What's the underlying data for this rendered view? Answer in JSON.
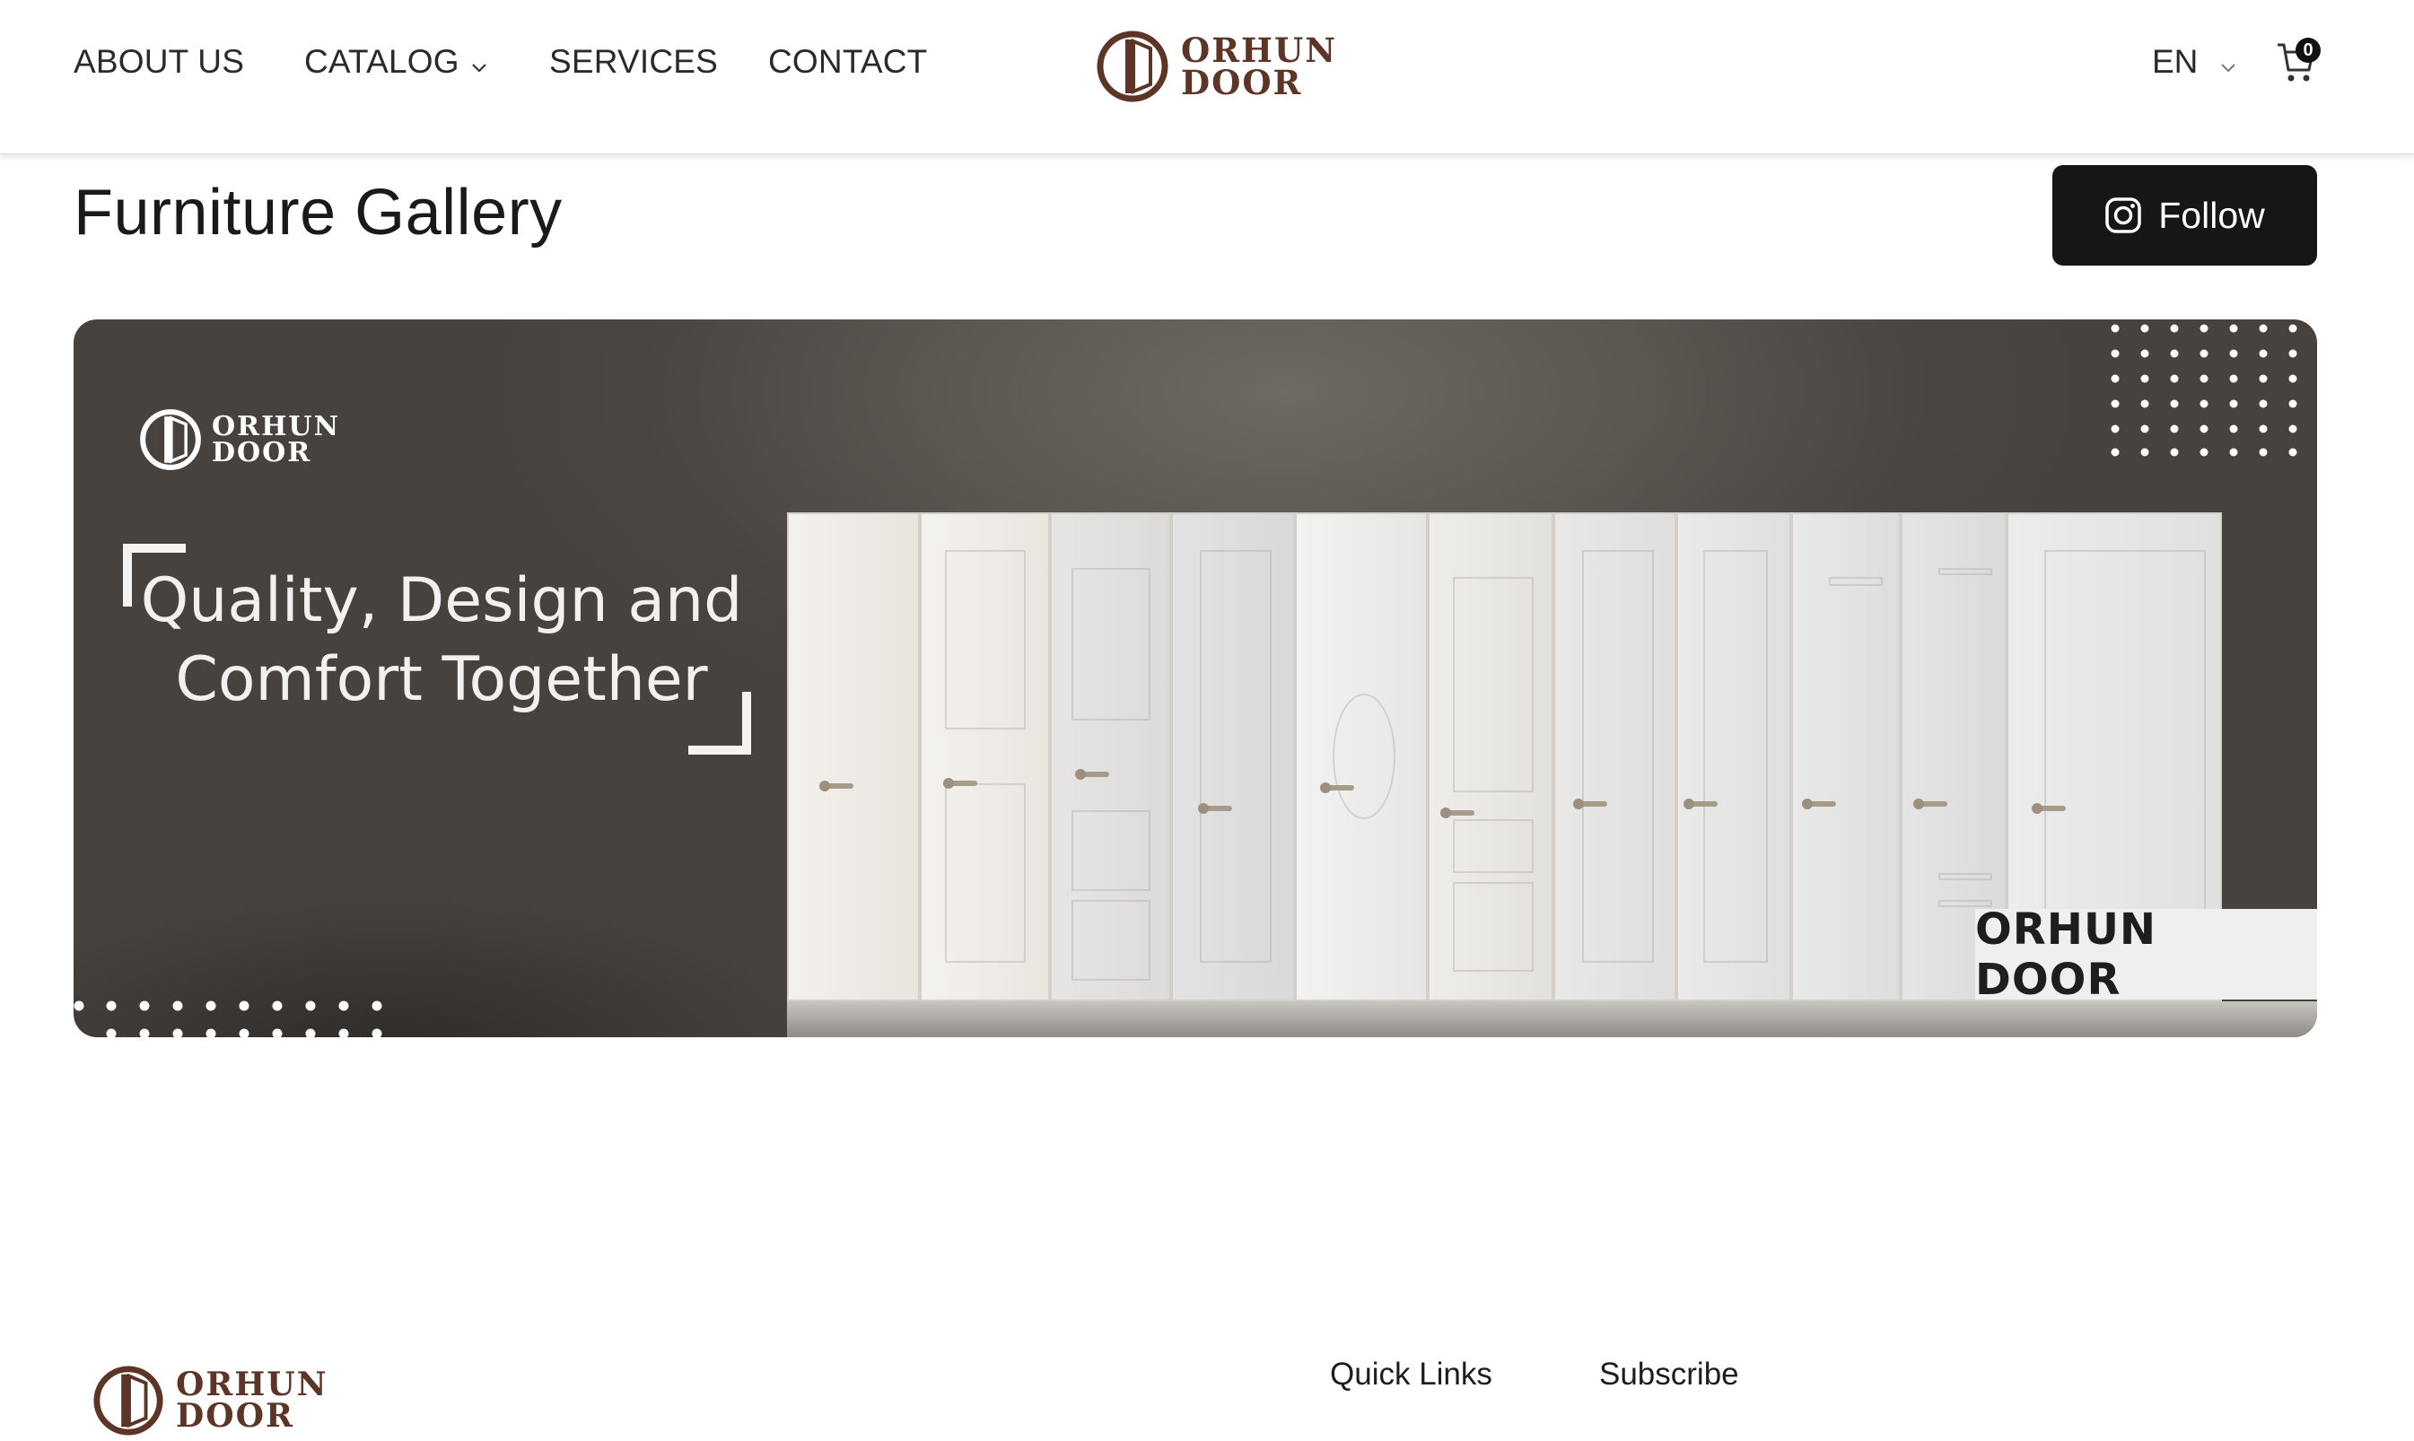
{
  "nav": {
    "items": [
      {
        "label": "ABOUT US"
      },
      {
        "label": "CATALOG"
      },
      {
        "label": "SERVICES"
      },
      {
        "label": "CONTACT"
      }
    ],
    "language": "EN",
    "cart_count": "0"
  },
  "brand": {
    "line1": "ORHUN",
    "line2": "DOOR",
    "color": "#5c3527"
  },
  "page": {
    "title": "Furniture Gallery",
    "follow_label": "Follow"
  },
  "banner": {
    "logo_line1": "ORHUN",
    "logo_line2": "DOOR",
    "tagline_line1": "Quality, Design and",
    "tagline_line2": "Comfort Together",
    "brand_label": "ORHUN DOOR"
  },
  "footer": {
    "logo_line1": "ORHUN",
    "logo_line2": "DOOR",
    "quick_links_heading": "Quick Links",
    "subscribe_heading": "Subscribe"
  }
}
